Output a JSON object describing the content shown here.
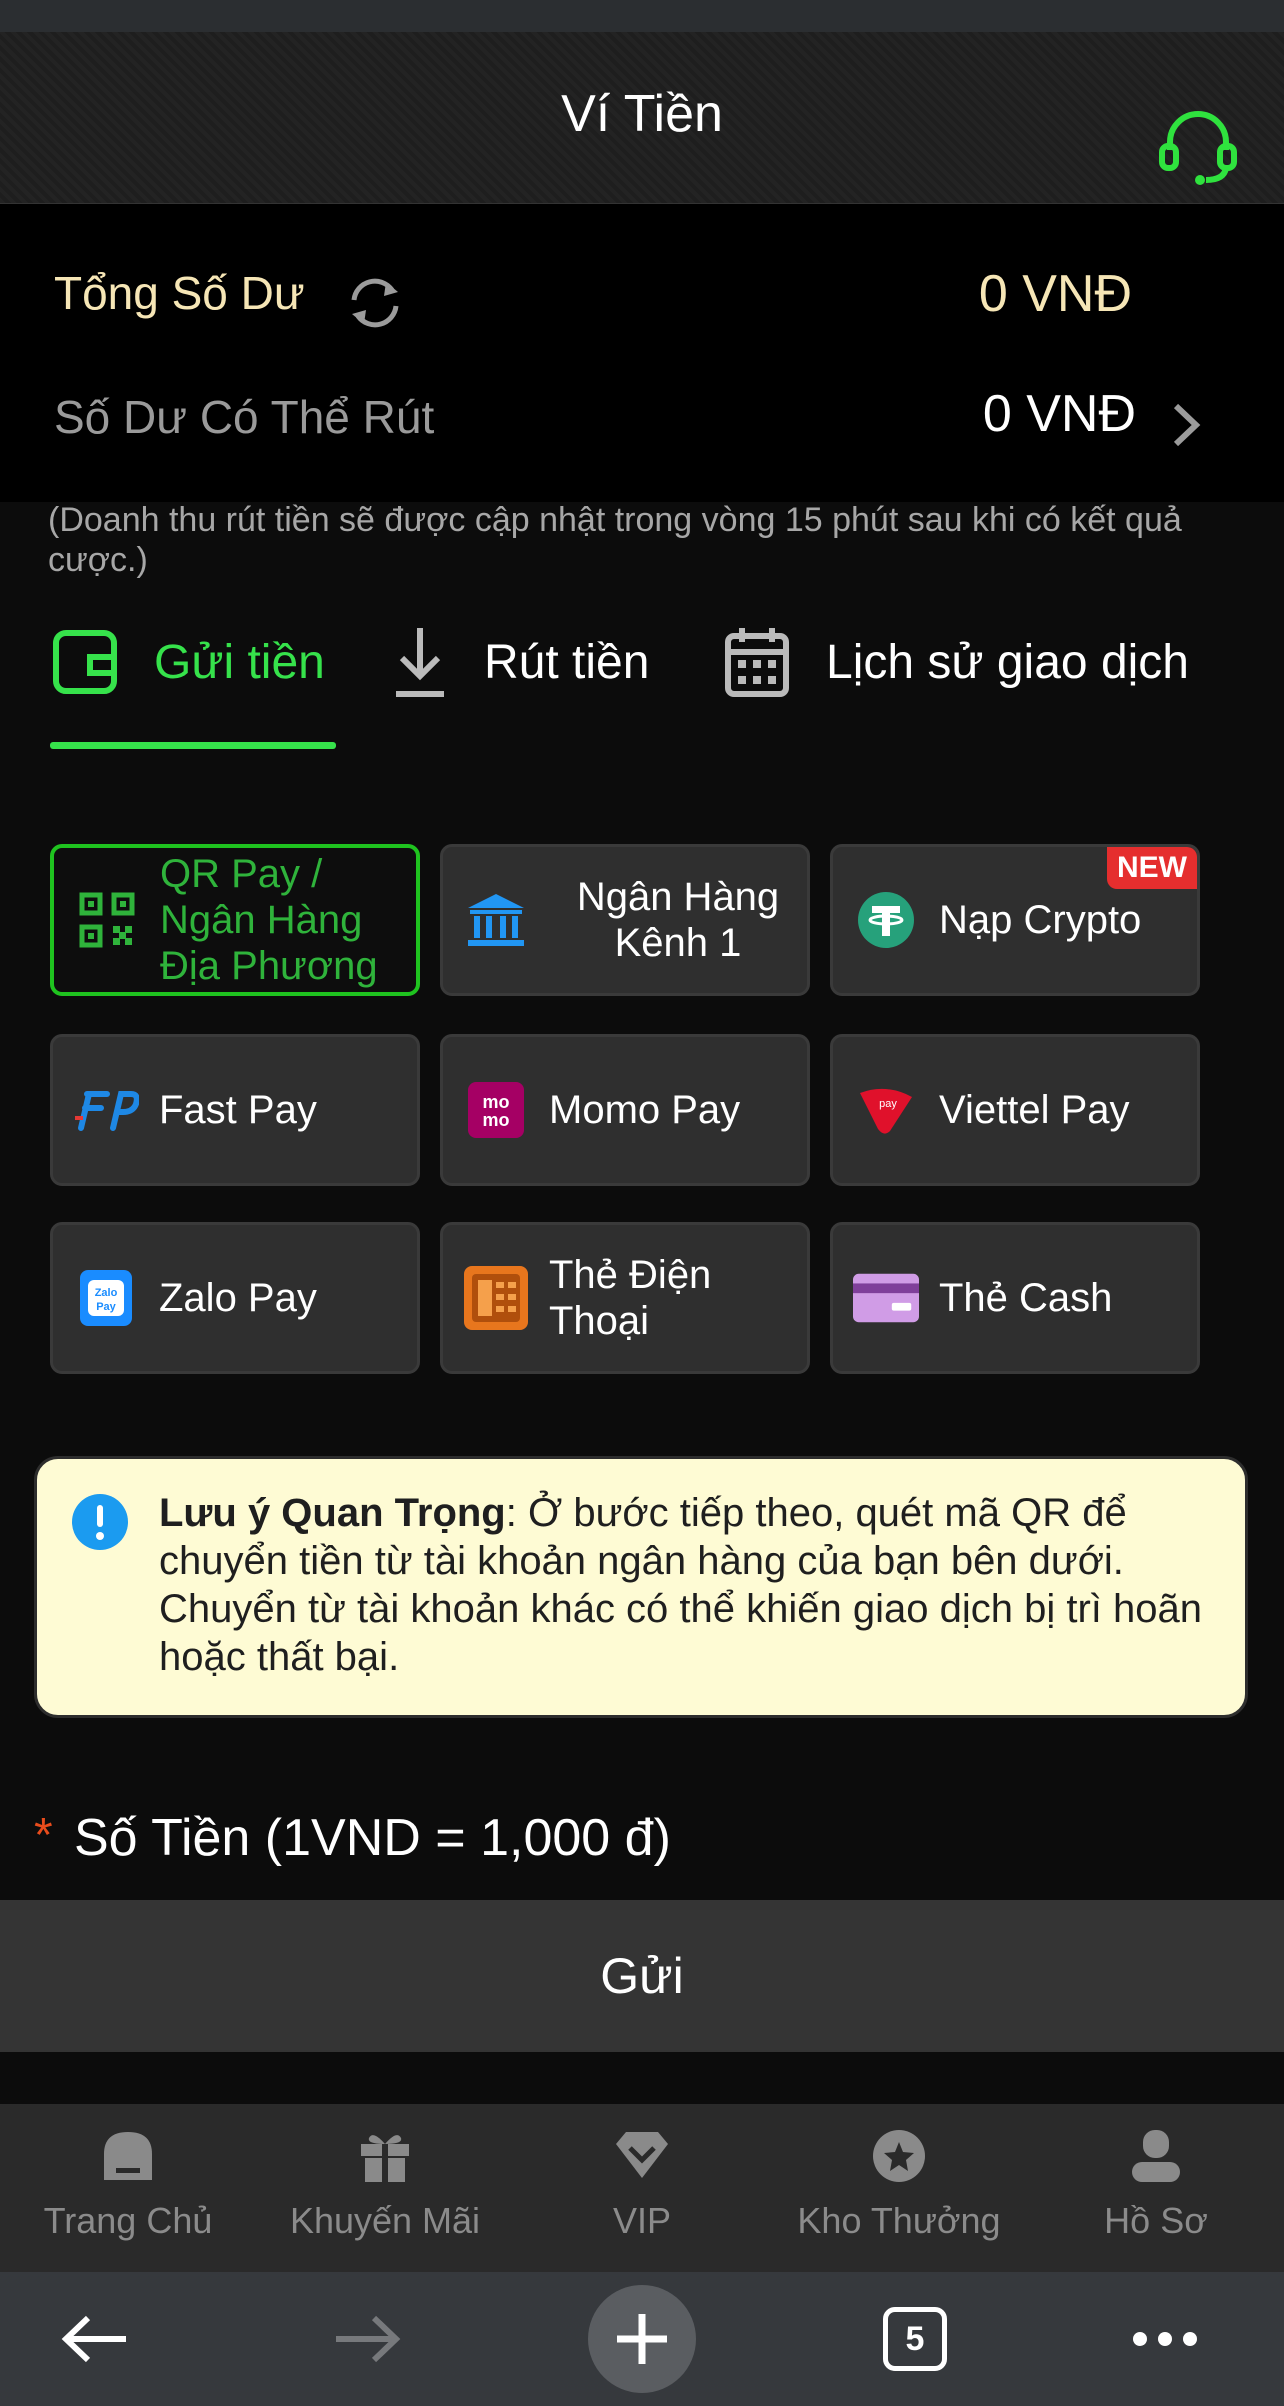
{
  "header": {
    "title": "Ví Tiền",
    "support_icon": "headset-icon"
  },
  "balance": {
    "total_label": "Tổng Số Dư",
    "total_value": "0 VNĐ",
    "withdrawable_label": "Số Dư Có Thể Rút",
    "withdrawable_value": "0 VNĐ"
  },
  "note": "(Doanh thu rút tiền sẽ được cập nhật trong vòng 15 phút sau khi có kết quả cược.)",
  "tabs": [
    {
      "label": "Gửi tiền",
      "icon": "wallet-icon",
      "active": true
    },
    {
      "label": "Rút tiền",
      "icon": "download-icon"
    },
    {
      "label": "Lịch sử giao dịch",
      "icon": "calendar-icon"
    }
  ],
  "methods": [
    {
      "label": "QR Pay / Ngân Hàng Địa Phương",
      "icon": "qr-code-icon"
    },
    {
      "label": "Ngân Hàng Kênh 1",
      "icon": "bank-icon"
    },
    {
      "label": "Nạp Crypto",
      "icon": "tether-icon",
      "badge": "NEW"
    },
    {
      "label": "Fast Pay",
      "icon": "fastpay-icon"
    },
    {
      "label": "Momo Pay",
      "icon": "momo-icon"
    },
    {
      "label": "Viettel Pay",
      "icon": "viettelpay-icon"
    },
    {
      "label": "Zalo Pay",
      "icon": "zalopay-icon"
    },
    {
      "label": "Thẻ Điện Thoại",
      "icon": "phone-card-icon"
    },
    {
      "label": "Thẻ Cash",
      "icon": "cash-card-icon"
    }
  ],
  "notice": {
    "title": "Lưu ý Quan Trọng",
    "body": ": Ở bước tiếp theo, quét mã QR để chuyển tiền từ tài khoản ngân hàng của bạn bên dưới. Chuyển từ tài khoản khác có thể khiến giao dịch bị trì hoãn hoặc thất bại."
  },
  "amount": {
    "required_mark": "*",
    "label": "Số Tiền (1VND = 1,000 đ)"
  },
  "submit_label": "Gửi",
  "bottom_nav": [
    {
      "label": "Trang Chủ",
      "icon": "home-icon"
    },
    {
      "label": "Khuyến Mãi",
      "icon": "gift-icon"
    },
    {
      "label": "VIP",
      "icon": "diamond-icon"
    },
    {
      "label": "Kho Thưởng",
      "icon": "star-badge-icon"
    },
    {
      "label": "Hồ Sơ",
      "icon": "user-icon"
    }
  ],
  "browser": {
    "tab_count": "5"
  },
  "colors": {
    "accent": "#36e24b",
    "gold": "#f6e6b6",
    "notice_bg": "#fefbd4"
  }
}
